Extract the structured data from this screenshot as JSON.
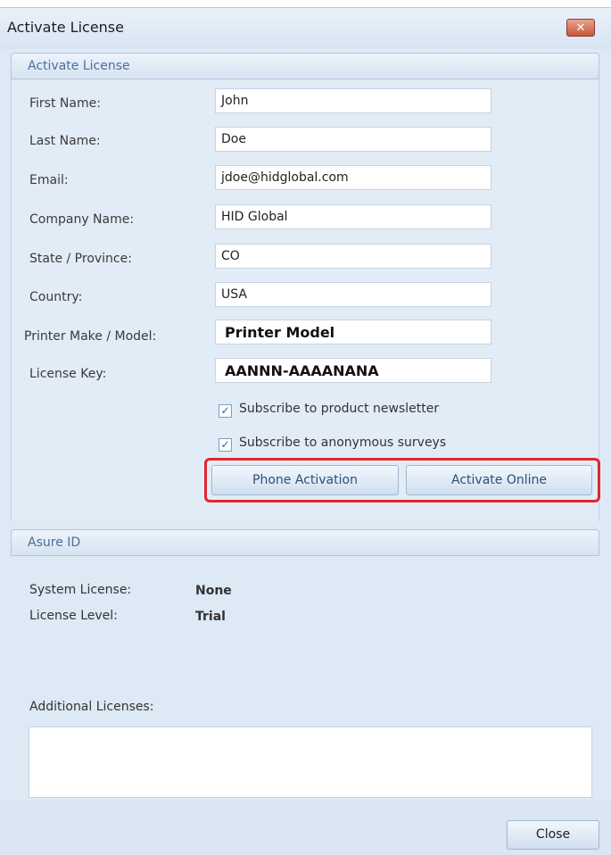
{
  "window": {
    "title": "Activate License",
    "close_glyph": "✕"
  },
  "activate_group": {
    "header": "Activate License",
    "fields": [
      {
        "label": "First Name:",
        "value": "John"
      },
      {
        "label": "Last Name:",
        "value": "Doe"
      },
      {
        "label": "Email:",
        "value": "jdoe@hidglobal.com"
      },
      {
        "label": "Company Name:",
        "value": "HID Global"
      },
      {
        "label": "State / Province:",
        "value": "CO"
      },
      {
        "label": "Country:",
        "value": "USA"
      },
      {
        "label": "Printer Make / Model:",
        "value": "Printer Model"
      },
      {
        "label": "License Key:",
        "value": "AANNN-AAAANANA"
      }
    ],
    "checkboxes": [
      {
        "label": "Subscribe to product newsletter",
        "checked": true,
        "mark": "✓"
      },
      {
        "label": "Subscribe to anonymous surveys",
        "checked": true,
        "mark": "✓"
      }
    ],
    "buttons": {
      "phone": "Phone Activation",
      "online": "Activate Online"
    }
  },
  "asure_group": {
    "header": "Asure ID",
    "system_license_label": "System License:",
    "system_license_value": "None",
    "license_level_label": "License Level:",
    "license_level_value": "Trial",
    "additional_licenses_label": "Additional Licenses:"
  },
  "footer": {
    "close_label": "Close"
  },
  "colors": {
    "highlight": "#e0262e",
    "window_bg": "#dde9f5",
    "accent_text": "#4a6fa0"
  }
}
